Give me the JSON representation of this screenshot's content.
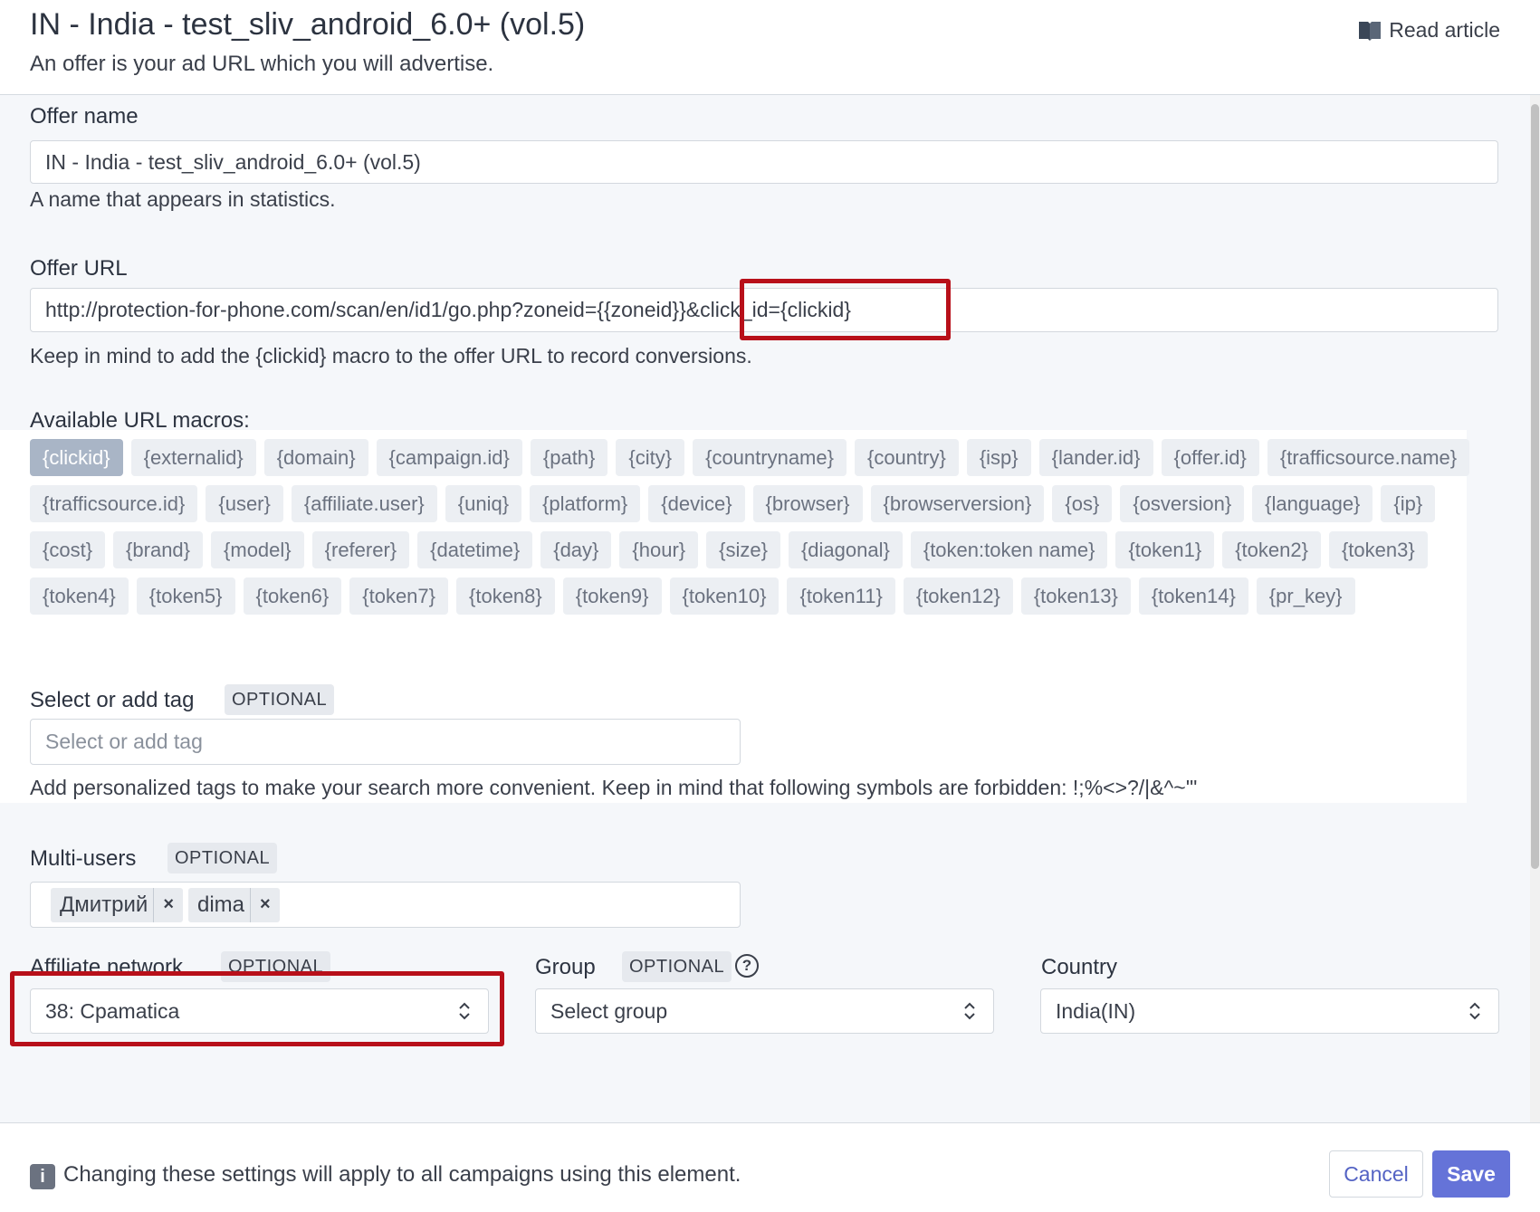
{
  "header": {
    "title": "IN - India - test_sliv_android_6.0+ (vol.5)",
    "subtitle": "An offer is your ad URL which you will advertise.",
    "read_article": "Read article",
    "read_article_icon": "book-icon"
  },
  "offer_name": {
    "label": "Offer name",
    "value": "IN - India - test_sliv_android_6.0+ (vol.5)",
    "help": "A name that appears in statistics."
  },
  "offer_url": {
    "label": "Offer URL",
    "value_part1": "http://protection-for-phone.com/scan/en/id1/go.php?zoneid={{zoneid}}",
    "value_part2": "&click_id={clickid}",
    "help": "Keep in mind to add the {clickid} macro to the offer URL to record conversions."
  },
  "macros": {
    "label": "Available URL macros:",
    "items": [
      "{clickid}",
      "{externalid}",
      "{domain}",
      "{campaign.id}",
      "{path}",
      "{city}",
      "{countryname}",
      "{country}",
      "{isp}",
      "{lander.id}",
      "{offer.id}",
      "{trafficsource.name}",
      "{trafficsource.id}",
      "{user}",
      "{affiliate.user}",
      "{uniq}",
      "{platform}",
      "{device}",
      "{browser}",
      "{browserversion}",
      "{os}",
      "{osversion}",
      "{language}",
      "{ip}",
      "{cost}",
      "{brand}",
      "{model}",
      "{referer}",
      "{datetime}",
      "{day}",
      "{hour}",
      "{size}",
      "{diagonal}",
      "{token:token name}",
      "{token1}",
      "{token2}",
      "{token3}",
      "{token4}",
      "{token5}",
      "{token6}",
      "{token7}",
      "{token8}",
      "{token9}",
      "{token10}",
      "{token11}",
      "{token12}",
      "{token13}",
      "{token14}",
      "{pr_key}"
    ]
  },
  "tags": {
    "label": "Select or add tag",
    "badge": "OPTIONAL",
    "placeholder": "Select or add tag",
    "help": "Add personalized tags to make your search more convenient. Keep in mind that following symbols are forbidden: !;%<>?/|&^~'\""
  },
  "multi_users": {
    "label": "Multi-users",
    "badge": "OPTIONAL",
    "chips": [
      "Дмитрий",
      "dima"
    ],
    "remove_glyph": "×"
  },
  "affiliate_network": {
    "label": "Affiliate network",
    "badge": "OPTIONAL",
    "value": "38: Cpamatica"
  },
  "group": {
    "label": "Group",
    "badge": "OPTIONAL",
    "help_glyph": "?",
    "placeholder": "Select group"
  },
  "country": {
    "label": "Country",
    "value": "India(IN)"
  },
  "footer": {
    "info_glyph": "i",
    "note": "Changing these settings will apply to all campaigns using this element.",
    "cancel": "Cancel",
    "save": "Save"
  },
  "colors": {
    "accent": "#6573d8",
    "highlight": "#b8101a",
    "macro_active": "#a9b5c6"
  }
}
